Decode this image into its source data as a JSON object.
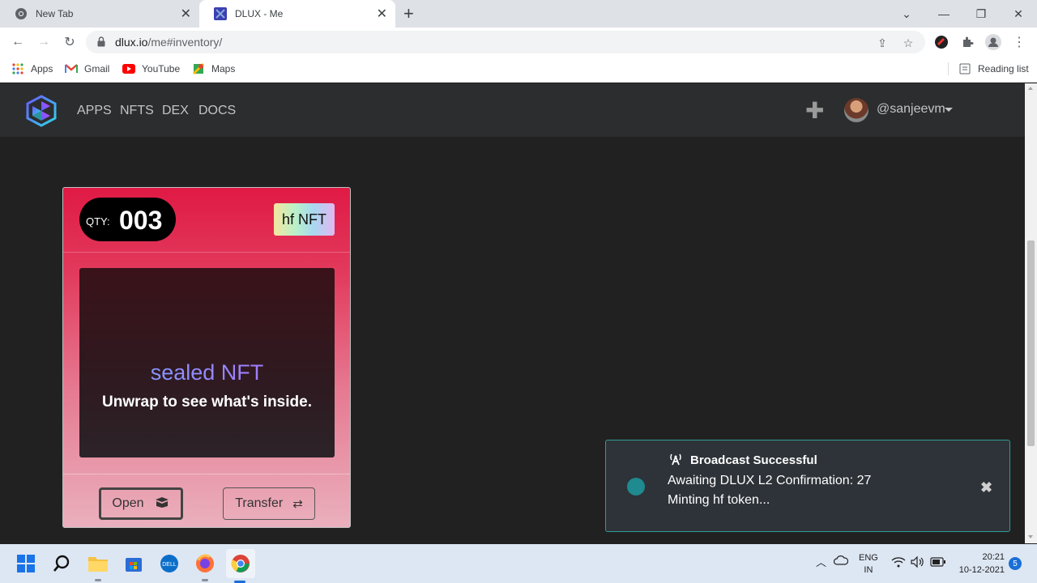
{
  "browser": {
    "tabs": [
      {
        "title": "New Tab",
        "active": false,
        "icon": "chrome-icon"
      },
      {
        "title": "DLUX - Me",
        "active": true,
        "icon": "dlux-icon"
      }
    ],
    "url_host": "dlux.io",
    "url_path": "/me#inventory/",
    "reading_list": "Reading list",
    "bookmarks": [
      "Apps",
      "Gmail",
      "YouTube",
      "Maps"
    ]
  },
  "site": {
    "nav": [
      "APPS",
      "NFTS",
      "DEX",
      "DOCS"
    ],
    "username": "@sanjeevm"
  },
  "card": {
    "qty_label": "QTY:",
    "qty_value": "003",
    "badge": "hf NFT",
    "sealed_title": "sealed NFT",
    "sealed_subtitle": "Unwrap to see what's inside.",
    "open_label": "Open",
    "transfer_label": "Transfer"
  },
  "toast": {
    "title": "Broadcast Successful",
    "line1": "Awaiting DLUX L2 Confirmation: 27",
    "line2": "Minting hf token..."
  },
  "taskbar": {
    "lang_top": "ENG",
    "lang_bottom": "IN",
    "time": "20:21",
    "date": "10-12-2021",
    "notifications": "5"
  },
  "colors": {
    "site_bg": "#212121",
    "nav_bg": "#2b2d2f",
    "card_top": "#e01a45",
    "toast_border": "#2f9a9a",
    "toast_dot": "#1f8a90"
  }
}
